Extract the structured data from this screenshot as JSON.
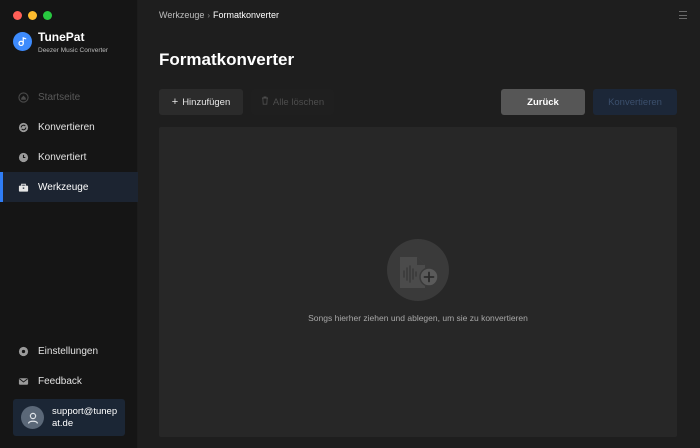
{
  "app": {
    "name": "TunePat",
    "subtitle": "Deezer Music Converter"
  },
  "sidebar": {
    "items": [
      {
        "label": "Startseite",
        "icon": "home-icon",
        "state": "disabled"
      },
      {
        "label": "Konvertieren",
        "icon": "convert-icon",
        "state": "normal"
      },
      {
        "label": "Konvertiert",
        "icon": "clock-icon",
        "state": "normal"
      },
      {
        "label": "Werkzeuge",
        "icon": "toolbox-icon",
        "state": "active"
      }
    ],
    "bottom_items": [
      {
        "label": "Einstellungen",
        "icon": "gear-icon"
      },
      {
        "label": "Feedback",
        "icon": "mail-icon"
      }
    ],
    "account_email": "support@tunepat.de"
  },
  "header": {
    "breadcrumb_parent": "Werkzeuge",
    "breadcrumb_separator": "›",
    "breadcrumb_current": "Formatkonverter"
  },
  "main": {
    "title": "Formatkonverter",
    "toolbar": {
      "add_label": "Hinzufügen",
      "clear_label": "Alle löschen",
      "back_label": "Zurück",
      "convert_label": "Konvertieren"
    },
    "dropzone_text": "Songs hierher ziehen und ablegen, um sie zu konvertieren"
  },
  "colors": {
    "accent": "#2f7df6",
    "sidebar_bg": "#151515",
    "main_bg": "#1e1e1e",
    "dropzone_bg": "#272727"
  }
}
